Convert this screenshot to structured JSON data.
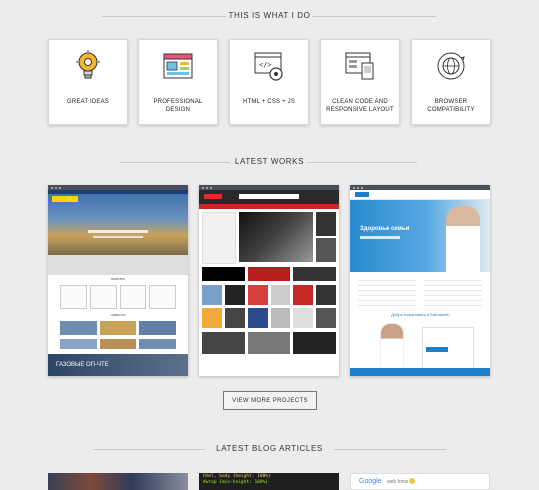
{
  "section1": {
    "title": "THIS IS WHAT I DO"
  },
  "services": [
    {
      "label": "GREAT IDEAS",
      "icon": "lightbulb-gear-icon"
    },
    {
      "label": "PROFESSIONAL DESIGN",
      "icon": "design-window-icon"
    },
    {
      "label": "HTML + CSS + JS",
      "icon": "code-gear-icon"
    },
    {
      "label": "CLEAN CODE AND RESPONSIVE LAYOUT",
      "icon": "responsive-devices-icon"
    },
    {
      "label": "BROWSER COMPATIBILITY",
      "icon": "browser-sync-icon"
    }
  ],
  "section2": {
    "title": "LATEST WORKS"
  },
  "works": [
    {
      "thumb1_title": "ПАЛИТРА",
      "thumb1_sub": "НОВОСТИ",
      "footer": "ГАЗОВЫЕ ОП-ЧТЕ"
    },
    {
      "shop": "Online Store"
    },
    {
      "hero": "Здоровье семьи",
      "welcome": "Добро пожаловать в БиКлиниК"
    }
  ],
  "view_more": "VIEW MORE PROJECTS",
  "section3": {
    "title": "LATEST BLOG ARTICLES"
  },
  "blog": [
    {
      "kind": "photo"
    },
    {
      "code_lines": [
        "html, body {height: 100%}",
        "#wrap {min-height: 100%}"
      ]
    },
    {
      "brand_a": "Google",
      "brand_b": "web fonts"
    }
  ],
  "colors": {
    "accent": "#1e7fc9",
    "bg": "#ececec"
  }
}
